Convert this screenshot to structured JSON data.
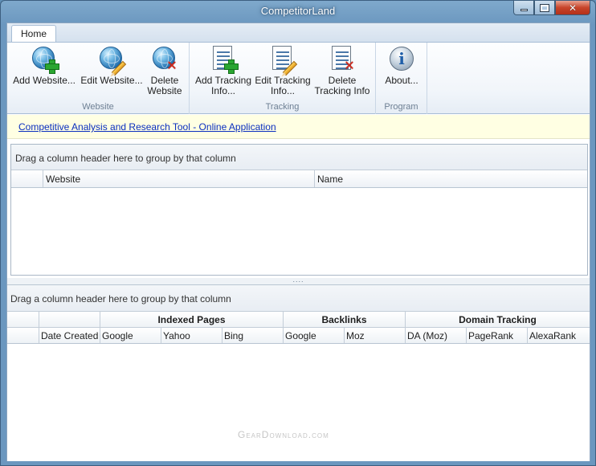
{
  "window": {
    "title": "CompetitorLand"
  },
  "ribbon": {
    "tabs": [
      {
        "label": "Home"
      }
    ],
    "groups": [
      {
        "label": "Website",
        "buttons": [
          {
            "label_line1": "Add Website...",
            "label_line2": "",
            "icon": "globe-add-icon"
          },
          {
            "label_line1": "Edit Website...",
            "label_line2": "",
            "icon": "globe-edit-icon"
          },
          {
            "label_line1": "Delete",
            "label_line2": "Website",
            "icon": "globe-delete-icon"
          }
        ]
      },
      {
        "label": "Tracking",
        "buttons": [
          {
            "label_line1": "Add Tracking",
            "label_line2": "Info...",
            "icon": "document-add-icon"
          },
          {
            "label_line1": "Edit Tracking",
            "label_line2": "Info...",
            "icon": "document-edit-icon"
          },
          {
            "label_line1": "Delete",
            "label_line2": "Tracking Info",
            "icon": "document-delete-icon"
          }
        ]
      },
      {
        "label": "Program",
        "buttons": [
          {
            "label_line1": "About...",
            "label_line2": "",
            "icon": "info-icon"
          }
        ]
      }
    ]
  },
  "infobar": {
    "link_text": "Competitive Analysis and Research Tool - Online Application"
  },
  "websites_grid": {
    "group_hint": "Drag a column header here to group by that column",
    "columns": [
      "Website",
      "Name"
    ]
  },
  "splitter": {
    "grip": "...."
  },
  "tracking_grid": {
    "group_hint": "Drag a column header here to group by that column",
    "bands": [
      "Indexed Pages",
      "Backlinks",
      "Domain Tracking"
    ],
    "columns": [
      "Date Created",
      "Google",
      "Yahoo",
      "Bing",
      "Google",
      "Moz",
      "DA (Moz)",
      "PageRank",
      "AlexaRank"
    ]
  },
  "watermark": "GearDownload.com"
}
